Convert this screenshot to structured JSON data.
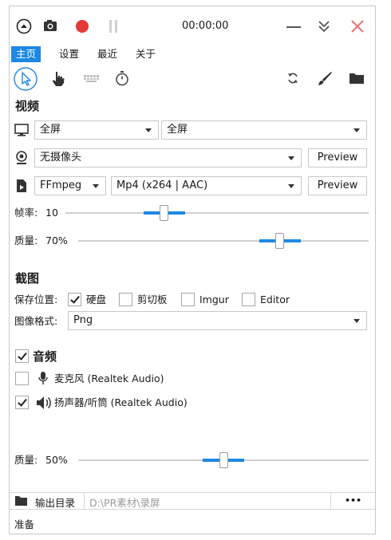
{
  "titlebar": {
    "timer": "00:00:00"
  },
  "menu": {
    "items": [
      "主页",
      "设置",
      "最近",
      "关于"
    ],
    "active_index": 0
  },
  "tools": {
    "pointer": "pointer-tool-icon",
    "hand": "hand-tool-icon",
    "keyboard": "keyboard-tool-icon",
    "timer": "stopwatch-tool-icon",
    "refresh": "refresh-icon",
    "brush": "brush-icon",
    "folder": "folder-icon"
  },
  "video": {
    "title": "视频",
    "screen_combo": "全屏",
    "screen_combo2": "全屏",
    "camera_combo": "无摄像头",
    "camera_preview": "Preview",
    "encoder_combo": "FFmpeg",
    "format_combo": "Mp4 (x264 | AAC)",
    "format_preview": "Preview",
    "fps_label": "帧率:",
    "fps_value": "10",
    "fps_level": 0.32,
    "quality_label": "质量:",
    "quality_value": "70%",
    "quality_level": 0.7
  },
  "screenshot": {
    "title": "截图",
    "save_label": "保存位置:",
    "targets": [
      {
        "label": "硬盘",
        "checked": true
      },
      {
        "label": "剪切板",
        "checked": false
      },
      {
        "label": "Imgur",
        "checked": false
      },
      {
        "label": "Editor",
        "checked": false
      }
    ],
    "format_label": "图像格式:",
    "format_value": "Png"
  },
  "audio": {
    "title": "音频",
    "enabled": true,
    "mic_label": "麦克风 (Realtek Audio)",
    "mic_checked": false,
    "speaker_label": "扬声器/听筒 (Realtek Audio)",
    "speaker_checked": true,
    "quality_label": "质量:",
    "quality_value": "50%",
    "quality_level": 0.5
  },
  "output": {
    "label": "输出目录",
    "path": "D:\\PR素材\\录屏",
    "more": "•••"
  },
  "status": {
    "text": "准备"
  },
  "colors": {
    "accent": "#1e88e5",
    "record": "#e53935",
    "close": "#e57373"
  }
}
